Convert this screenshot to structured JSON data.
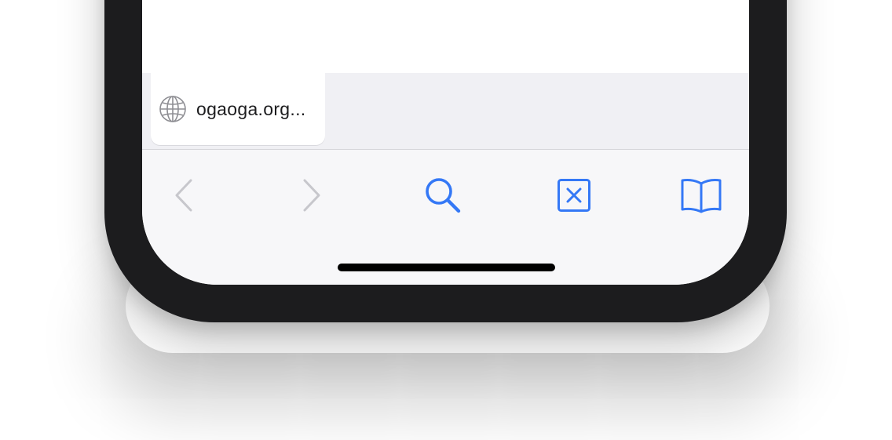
{
  "tab": {
    "label": "ogaoga.org..."
  },
  "toolbar": {
    "back": {
      "enabled": false
    },
    "forward": {
      "enabled": false
    },
    "search": {
      "enabled": true
    },
    "close_tab": {
      "enabled": true
    },
    "bookmarks": {
      "enabled": true
    }
  },
  "icons": {
    "globe": "globe-icon",
    "back": "chevron-left-icon",
    "forward": "chevron-right-icon",
    "search": "magnifying-glass-icon",
    "close_tab": "x-square-icon",
    "bookmarks": "book-icon"
  },
  "colors": {
    "accent": "#3478f6",
    "disabled": "#c7c7cc",
    "bezel": "#1c1c1e",
    "tab_strip": "#f0f0f4",
    "toolbar": "#f7f7f9"
  }
}
